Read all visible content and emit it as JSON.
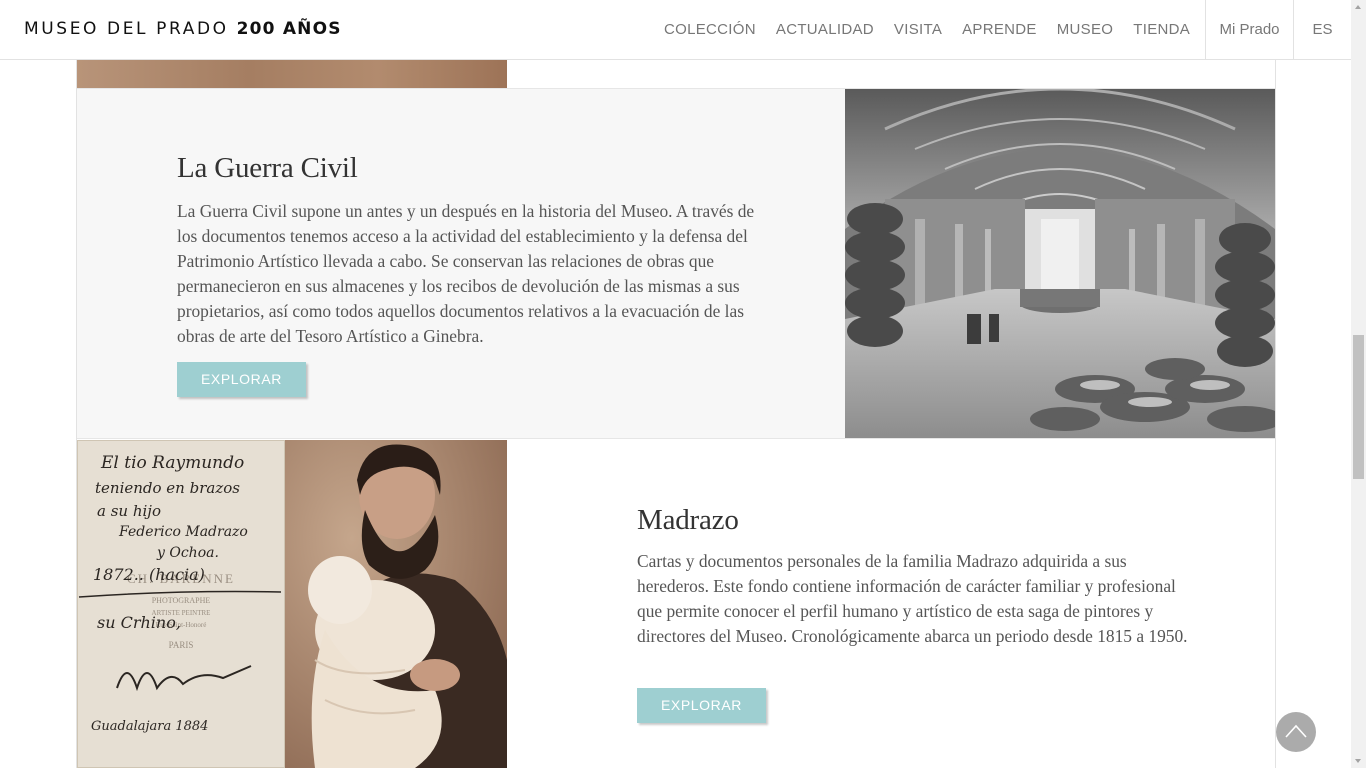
{
  "header": {
    "logo_main": "MUSEO DEL PRADO",
    "logo_bold": "200 AÑOS",
    "nav": [
      "COLECCIÓN",
      "ACTUALIDAD",
      "VISITA",
      "APRENDE",
      "MUSEO",
      "TIENDA"
    ],
    "mi_prado": "Mi Prado",
    "language": "ES"
  },
  "sections": [
    {
      "title": "La Guerra Civil",
      "text": "La Guerra Civil supone un antes y un después en la historia del Museo. A través de los documentos tenemos acceso a la actividad del establecimiento y la defensa del Patrimonio Artístico llevada a cabo. Se conservan las relaciones de obras que permanecieron en sus almacenes y los recibos de devolución de las mismas a sus propietarios, así como todos aquellos documentos relativos a la evacuación de las obras de arte del Tesoro Artístico a Ginebra.",
      "button": "EXPLORAR"
    },
    {
      "title": "Madrazo",
      "text": "Cartas y documentos personales de la familia Madrazo adquirida a sus herederos. Este fondo contiene información de carácter familiar y profesional que permite conocer el perfil humano y artístico de esta saga de pintores y directores del Museo. Cronológicamente abarca un periodo desde 1815 a 1950.",
      "button": "EXPLORAR"
    }
  ],
  "letter": {
    "lines": [
      "El tio Raymundo",
      "teniendo en brazos",
      "a su hijo",
      "Federico Madrazo",
      "y Ochoa.",
      "1872.. (hacia)",
      "su Crhino,",
      "Guadalajara 1884"
    ],
    "stamp": [
      "CH. BARENNE",
      "PHOTOGRAPHE",
      "ARTISTE PEINTRE",
      "Rue Saint-Honoré",
      "PARIS"
    ]
  },
  "colors": {
    "accent_button": "#9ecfd1",
    "section_bg": "#f7f7f7"
  },
  "icons": {
    "scroll_top": "chevron-up-icon"
  }
}
